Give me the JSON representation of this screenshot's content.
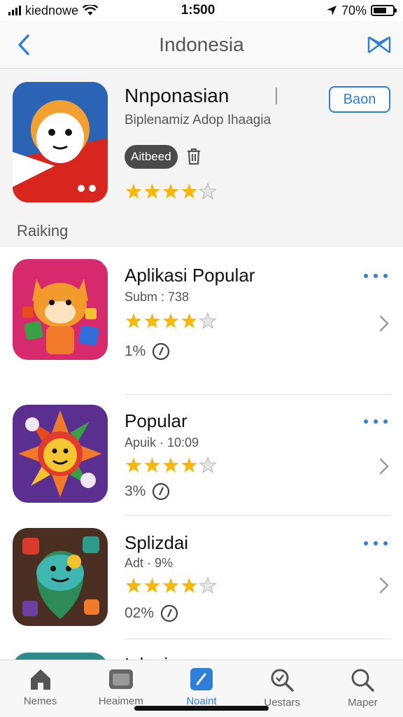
{
  "status_bar": {
    "carrier": "kiednowe",
    "time": "1:500",
    "battery": "70%",
    "battery_level": 0.7
  },
  "nav": {
    "title": "Indonesia"
  },
  "featured": {
    "title": "Nnponasian",
    "subtitle": "Biplenamiz Adop Ihaagia",
    "badge": "Aitbeed",
    "get_label": "Baon",
    "rating": 4,
    "section_label": "Raiking"
  },
  "apps": [
    {
      "title": "Aplikasi Popular",
      "subtitle": "Subm : 738",
      "rating": 4,
      "meta": "1%"
    },
    {
      "title": "Popular",
      "subtitle": "Apuik · 10:09",
      "rating": 4,
      "meta": "3%"
    },
    {
      "title": "Splizdai",
      "subtitle": "Adt · 9%",
      "rating": 4,
      "meta": "02%"
    }
  ],
  "partial_row_title": "Iulani",
  "tabs": [
    {
      "label": "Nemes",
      "icon": "home-icon"
    },
    {
      "label": "Heaimem",
      "icon": "photo-icon"
    },
    {
      "label": "Noaint",
      "icon": "edit-icon",
      "active": true
    },
    {
      "label": "Uestars",
      "icon": "search-icon"
    },
    {
      "label": "Maper",
      "icon": "magnifier-icon"
    }
  ],
  "colors": {
    "accent": "#2f7fd8",
    "star": "#f5b80f"
  }
}
